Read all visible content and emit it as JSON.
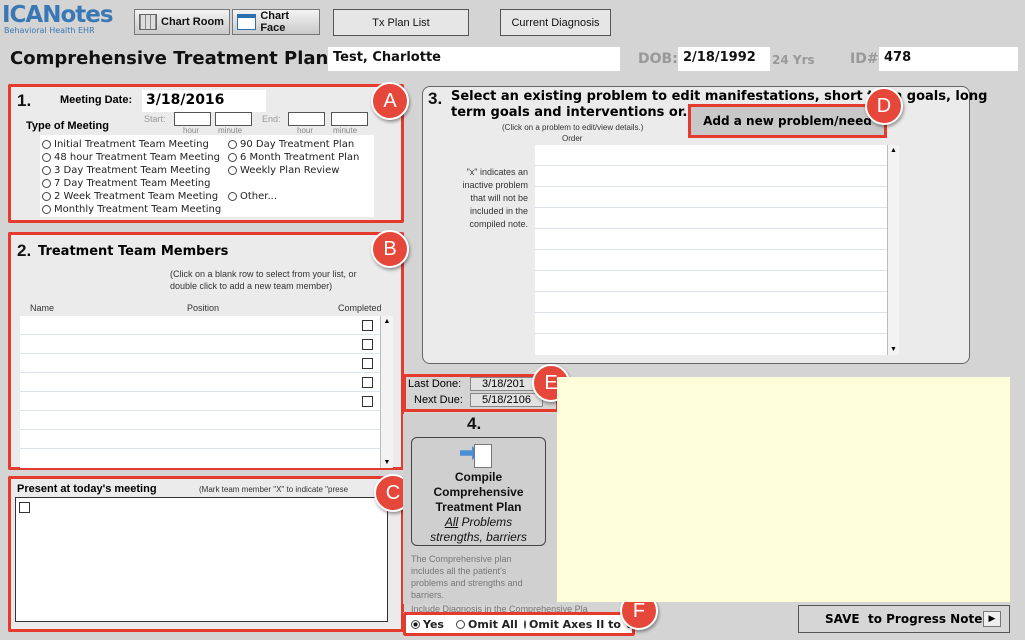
{
  "logo": {
    "text": "ICANotes",
    "subtext": "Behavioral Health EHR"
  },
  "toolbar": {
    "chart_room": "Chart Room",
    "chart_face": "Chart Face",
    "tx_plan_list": "Tx Plan List",
    "current_diagnosis": "Current Diagnosis"
  },
  "header": {
    "title": "Comprehensive Treatment Plan for",
    "patient": "Test, Charlotte",
    "dob_label": "DOB:",
    "dob": "2/18/1992",
    "age": "24 Yrs",
    "id_label": "ID#:",
    "id": "478"
  },
  "section1": {
    "num": "1.",
    "meeting_date_label": "Meeting Date:",
    "meeting_date": "3/18/2016",
    "type_label": "Type of Meeting",
    "start_label": "Start:",
    "end_label": "End:",
    "hour": "hour",
    "minute": "minute",
    "options": [
      "Initial Treatment Team Meeting",
      "90 Day Treatment Plan",
      "48 hour Treatment Team Meeting",
      "6 Month Treatment Plan",
      "3 Day Treatment Team Meeting",
      "Weekly Plan Review",
      "7 Day Treatment Team Meeting",
      "2 Week Treatment Team Meeting",
      "Other...",
      "Monthly Treatment Team Meeting"
    ]
  },
  "section2": {
    "num": "2.",
    "title": "Treatment Team Members",
    "hint": "(Click on a blank row to select from your list, or double click to add a new team member)",
    "col_name": "Name",
    "col_position": "Position",
    "col_completed": "Completed"
  },
  "present": {
    "title": "Present at today's meeting",
    "hint": "(Mark team member \"X\" to indicate \"prese"
  },
  "section3": {
    "num": "3.",
    "title_line1": "Select an existing problem to edit manifestations, short term goals, long",
    "title_line2": "term goals and interventions or...",
    "hint": "(Click on a problem to edit/view details.)",
    "order_label": "Order",
    "add_button": "Add a new problem/need",
    "x_note": "\"x\" indicates an inactive problem that will not be included in the compiled note."
  },
  "dates": {
    "last_done_label": "Last Done:",
    "last_done": "3/18/201",
    "next_due_label": "Next Due:",
    "next_due": "5/18/2106"
  },
  "section4": {
    "num": "4.",
    "compile_l1": "Compile",
    "compile_l2": "Comprehensive",
    "compile_l3": "Treatment Plan",
    "compile_l4a": "All",
    "compile_l4b": " Problems",
    "compile_l5": "strengths, barriers",
    "desc": "The Comprehensive plan includes all the patient's problems and strengths and barriers.",
    "diag_label": "Include Diagnosis in the Comprehensive Pla",
    "opt_yes": "Yes",
    "opt_omit_all": "Omit All",
    "opt_omit_axes": "Omit Axes II to V"
  },
  "save_button": "SAVE  to Progress Notes",
  "badges": [
    "A",
    "B",
    "C",
    "D",
    "E",
    "F"
  ]
}
